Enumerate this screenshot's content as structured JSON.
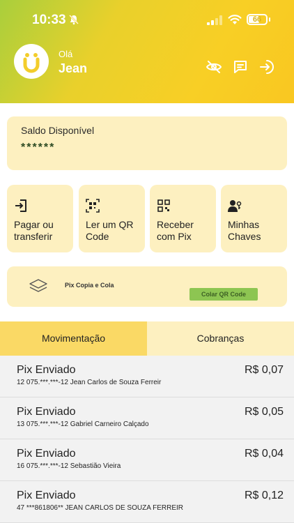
{
  "status_bar": {
    "time": "10:33",
    "battery": "66",
    "battery_level": 0.66
  },
  "header": {
    "greeting": "Olá",
    "user_name": "Jean"
  },
  "balance": {
    "label": "Saldo Disponível",
    "value": "******"
  },
  "actions": [
    {
      "label": "Pagar ou transferir",
      "icon": "transfer-icon"
    },
    {
      "label": "Ler um QR Code",
      "icon": "qr-scan-icon"
    },
    {
      "label": "Receber com Pix",
      "icon": "qr-receive-icon"
    },
    {
      "label": "Minhas Chaves",
      "icon": "user-key-icon"
    }
  ],
  "pix_copia": {
    "title": "Pix Copia e Cola",
    "button": "Colar QR Code"
  },
  "tabs": [
    {
      "label": "Movimentação",
      "active": true
    },
    {
      "label": "Cobranças",
      "active": false
    }
  ],
  "transactions": [
    {
      "title": "Pix Enviado",
      "detail": "12 075.***.***-12 Jean Carlos de Souza Ferreir",
      "amount": "R$ 0,07"
    },
    {
      "title": "Pix Enviado",
      "detail": "13 075.***.***-12 Gabriel Carneiro Calçado",
      "amount": "R$ 0,05"
    },
    {
      "title": "Pix Enviado",
      "detail": "16 075.***.***-12 Sebastião Vieira",
      "amount": "R$ 0,04"
    },
    {
      "title": "Pix Enviado",
      "detail": "47 ***861806** JEAN CARLOS DE SOUZA FERREIR",
      "amount": "R$ 0,12"
    }
  ],
  "colors": {
    "accent": "#f8cf25",
    "card": "#fdf0c0",
    "active_tab": "#fad965",
    "button": "#8dc552"
  }
}
